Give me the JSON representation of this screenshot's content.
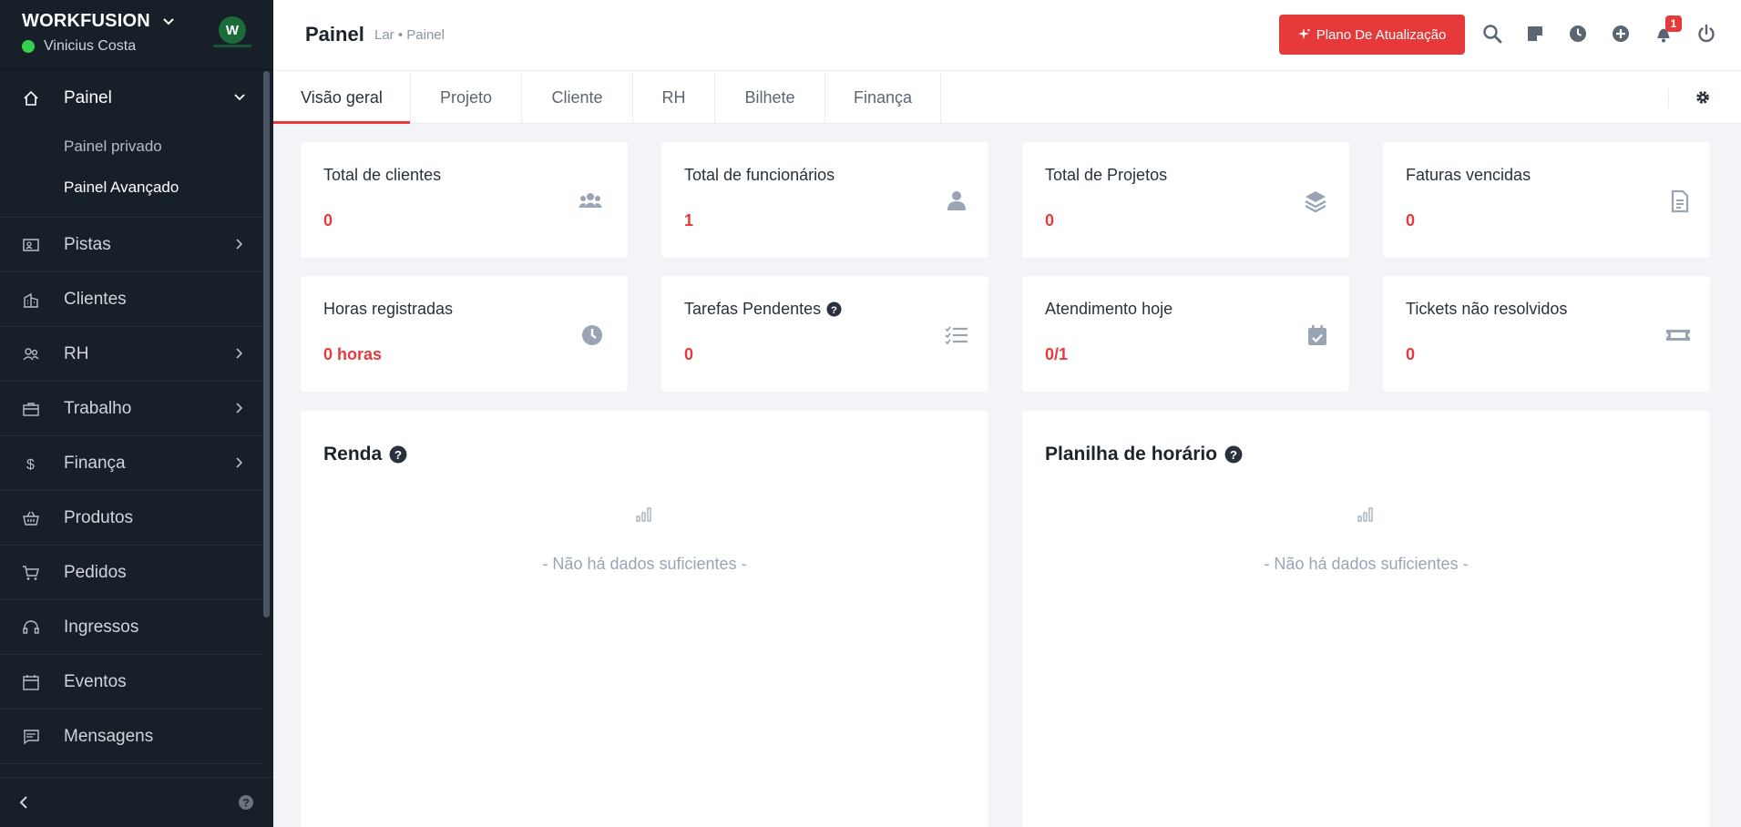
{
  "sidebar": {
    "brand": "WORKFUSION",
    "user_name": "Vinicius Costa",
    "avatar_initial": "W",
    "items": [
      {
        "label": "Painel",
        "icon": "home-icon",
        "expanded": true
      },
      {
        "label": "Pistas",
        "icon": "contact-card-icon"
      },
      {
        "label": "Clientes",
        "icon": "building-icon"
      },
      {
        "label": "RH",
        "icon": "people-icon"
      },
      {
        "label": "Trabalho",
        "icon": "briefcase-icon"
      },
      {
        "label": "Finança",
        "icon": "dollar-icon"
      },
      {
        "label": "Produtos",
        "icon": "basket-icon"
      },
      {
        "label": "Pedidos",
        "icon": "cart-icon"
      },
      {
        "label": "Ingressos",
        "icon": "headset-icon"
      },
      {
        "label": "Eventos",
        "icon": "calendar-icon"
      },
      {
        "label": "Mensagens",
        "icon": "message-icon"
      }
    ],
    "subitems": [
      {
        "label": "Painel privado"
      },
      {
        "label": "Painel Avançado"
      }
    ]
  },
  "header": {
    "title": "Painel",
    "breadcrumb": "Lar • Painel",
    "upgrade_label": "Plano De Atualização",
    "notification_count": "1"
  },
  "tabs": [
    {
      "label": "Visão geral"
    },
    {
      "label": "Projeto"
    },
    {
      "label": "Cliente"
    },
    {
      "label": "RH"
    },
    {
      "label": "Bilhete"
    },
    {
      "label": "Finança"
    }
  ],
  "stats": [
    {
      "title": "Total de clientes",
      "value": "0",
      "icon": "users-icon"
    },
    {
      "title": "Total de funcionários",
      "value": "1",
      "icon": "user-icon"
    },
    {
      "title": "Total de Projetos",
      "value": "0",
      "icon": "layers-icon"
    },
    {
      "title": "Faturas vencidas",
      "value": "0",
      "icon": "invoice-icon"
    },
    {
      "title": "Horas registradas",
      "value": "0 horas",
      "icon": "clock-icon"
    },
    {
      "title": "Tarefas Pendentes",
      "value": "0",
      "icon": "tasks-icon"
    },
    {
      "title": "Atendimento hoje",
      "value": "0/1",
      "icon": "calendar-check-icon"
    },
    {
      "title": "Tickets não resolvidos",
      "value": "0",
      "icon": "ticket-icon"
    }
  ],
  "panels": [
    {
      "title": "Renda",
      "empty": "- Não há dados suficientes -"
    },
    {
      "title": "Planilha de horário",
      "empty": "- Não há dados suficientes -"
    }
  ],
  "colors": {
    "accent": "#e63a3a",
    "sidebar": "#171f29",
    "online": "#36d04e"
  }
}
